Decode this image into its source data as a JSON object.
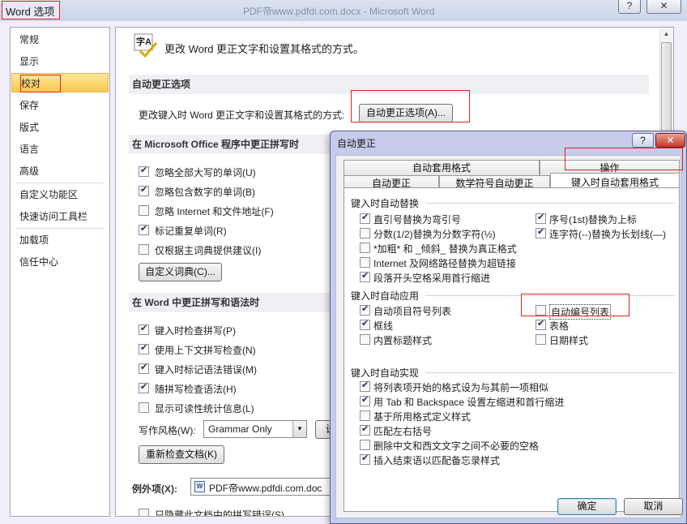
{
  "outer": {
    "title": "Word 选项",
    "faded_title": "PDF帝www.pdfdi.com.docx - Microsoft Word",
    "help_label": "?",
    "close_label": "✕"
  },
  "nav": {
    "items": [
      {
        "label": "常规"
      },
      {
        "label": "显示"
      },
      {
        "label": "校对"
      },
      {
        "label": "保存"
      },
      {
        "label": "版式"
      },
      {
        "label": "语言"
      },
      {
        "label": "高级"
      },
      {
        "label": "自定义功能区"
      },
      {
        "label": "快速访问工具栏"
      },
      {
        "label": "加载项"
      },
      {
        "label": "信任中心"
      }
    ],
    "selected_index": 2
  },
  "main": {
    "intro_icon_text": "字A",
    "intro_text": "更改 Word 更正文字和设置其格式的方式。",
    "autocorrect_section": "自动更正选项",
    "autocorrect_desc": "更改键入时 Word 更正文字和设置其格式的方式:",
    "autocorrect_button": "自动更正选项(A)...",
    "office_section": "在 Microsoft Office 程序中更正拼写时",
    "office_opts": [
      {
        "label": "忽略全部大写的单词(U)",
        "checked": true
      },
      {
        "label": "忽略包含数字的单词(B)",
        "checked": true
      },
      {
        "label": "忽略 Internet 和文件地址(F)",
        "checked": false
      },
      {
        "label": "标记重复单词(R)",
        "checked": true
      },
      {
        "label": "仅根据主词典提供建议(I)",
        "checked": false
      }
    ],
    "custom_dict_button": "自定义词典(C)...",
    "word_section": "在 Word 中更正拼写和语法时",
    "word_opts": [
      {
        "label": "键入时检查拼写(P)",
        "checked": true
      },
      {
        "label": "使用上下文拼写检查(N)",
        "checked": true
      },
      {
        "label": "键入时标记语法错误(M)",
        "checked": true
      },
      {
        "label": "随拼写检查语法(H)",
        "checked": true
      },
      {
        "label": "显示可读性统计信息(L)",
        "checked": false
      }
    ],
    "style_label": "写作风格(W):",
    "style_value": "Grammar Only",
    "style_settings_partial": "设",
    "recheck_button": "重新检查文档(K)",
    "exceptions_label": "例外项(X):",
    "exceptions_value": "PDF帝www.pdfdi.com.doc",
    "last_option_partial": "只隐藏此文档中的拼写错误(S)"
  },
  "dialog": {
    "title": "自动更正",
    "help_label": "?",
    "close_label": "✕",
    "tabs_row1": [
      "自动套用格式",
      "操作"
    ],
    "tabs_row2": [
      "自动更正",
      "数学符号自动更正",
      "键入时自动套用格式"
    ],
    "group_replace": "键入时自动替换",
    "replace_left": [
      {
        "label": "直引号替换为弯引号",
        "checked": true
      },
      {
        "label": "分数(1/2)替换为分数字符(½)",
        "checked": false
      },
      {
        "label": "*加粗* 和 _倾斜_ 替换为真正格式",
        "checked": false
      },
      {
        "label": "Internet 及网络路径替换为超链接",
        "checked": false
      },
      {
        "label": "段落开头空格采用首行缩进",
        "checked": true
      }
    ],
    "replace_right": [
      {
        "label": "序号(1st)替换为上标",
        "checked": true
      },
      {
        "label": "连字符(--)替换为长划线(—)",
        "checked": true
      }
    ],
    "group_apply": "键入时自动应用",
    "apply_left": [
      {
        "label": "自动项目符号列表",
        "checked": true
      },
      {
        "label": "框线",
        "checked": true
      },
      {
        "label": "内置标题样式",
        "checked": false
      }
    ],
    "apply_right": [
      {
        "label": "自动编号列表",
        "checked": false
      },
      {
        "label": "表格",
        "checked": true
      },
      {
        "label": "日期样式",
        "checked": false
      }
    ],
    "group_realize": "键入时自动实现",
    "realize": [
      {
        "label": "将列表项开始的格式设为与其前一项相似",
        "checked": true
      },
      {
        "label": "用 Tab 和 Backspace 设置左缩进和首行缩进",
        "checked": true
      },
      {
        "label": "基于所用格式定义样式",
        "checked": false
      },
      {
        "label": "匹配左右括号",
        "checked": true
      },
      {
        "label": "删除中文和西文文字之间不必要的空格",
        "checked": false
      },
      {
        "label": "插入结束语以匹配备忘录样式",
        "checked": true
      }
    ],
    "ok_button": "确定",
    "cancel_button": "取消"
  }
}
